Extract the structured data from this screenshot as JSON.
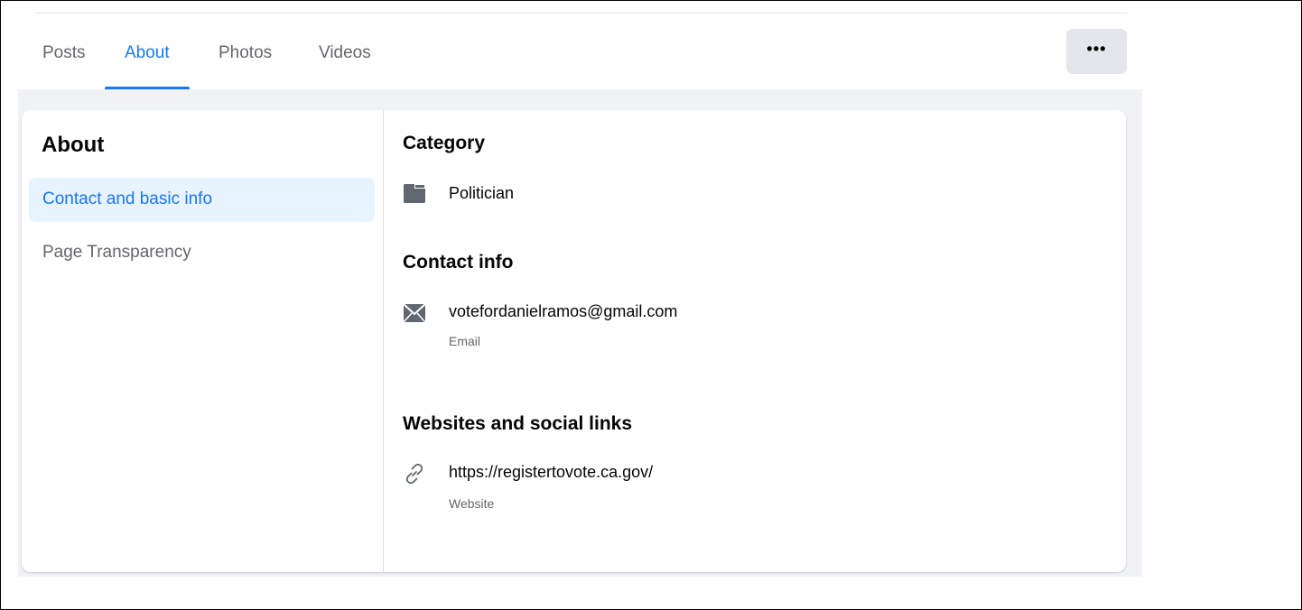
{
  "tabs": [
    {
      "label": "Posts",
      "active": false
    },
    {
      "label": "About",
      "active": true
    },
    {
      "label": "Photos",
      "active": false
    },
    {
      "label": "Videos",
      "active": false
    }
  ],
  "more_button": {
    "label": "•••"
  },
  "sidebar": {
    "title": "About",
    "items": [
      {
        "label": "Contact and basic info",
        "selected": true
      },
      {
        "label": "Page Transparency",
        "selected": false
      }
    ]
  },
  "details": {
    "category": {
      "heading": "Category",
      "value": "Politician",
      "icon": "category-folder-icon"
    },
    "contact": {
      "heading": "Contact info",
      "email": "votefordanielramos@gmail.com",
      "email_caption": "Email",
      "icon": "envelope-icon"
    },
    "websites": {
      "heading": "Websites and social links",
      "url": "https://registertovote.ca.gov/",
      "url_caption": "Website",
      "icon": "link-icon"
    }
  },
  "colors": {
    "accent": "#1877f2",
    "selected_bg": "#e7f3ff",
    "secondary_text": "#65676b",
    "primary_text": "#050505",
    "page_bg": "#f0f2f5",
    "button_bg": "#e4e6eb"
  }
}
